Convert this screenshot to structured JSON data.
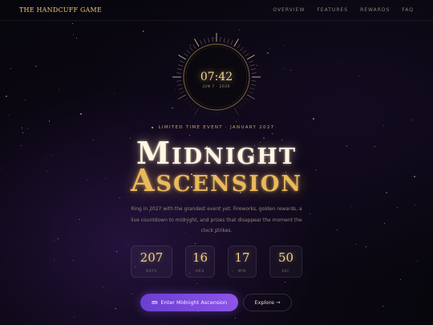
{
  "header": {
    "logo": "THE HANDCUFF GAME",
    "nav": [
      "OVERVIEW",
      "FEATURES",
      "REWARDS",
      "FAQ"
    ]
  },
  "clock": {
    "time": "07:42",
    "date": "JUN 7 · 2026"
  },
  "hero": {
    "kicker": "LIMITED TIME EVENT · JANUARY 2027",
    "title_line1": "Midnight",
    "title_line2": "Ascension",
    "description": "Ring in 2027 with the grandest event yet. Fireworks, golden rewards, a live countdown to midnight, and prizes that disappear the moment the clock strikes."
  },
  "countdown": [
    {
      "value": "207",
      "label": "DAYS"
    },
    {
      "value": "16",
      "label": "HRS"
    },
    {
      "value": "17",
      "label": "MIN"
    },
    {
      "value": "50",
      "label": "SEC"
    }
  ],
  "actions": {
    "primary_label": "Enter Midnight Ascension",
    "primary_icon": "ticket-icon",
    "secondary_label": "Explore →"
  },
  "colors": {
    "gold": "#e9b95c",
    "accent": "#7c4ddd",
    "background": "#08060d"
  }
}
